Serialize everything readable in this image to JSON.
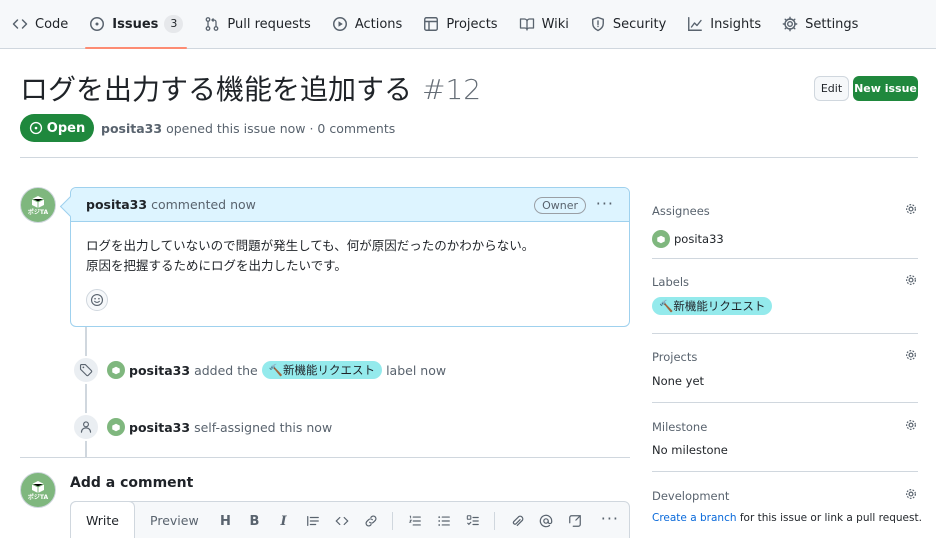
{
  "nav": {
    "items": [
      {
        "label": "Code",
        "icon": "code-icon"
      },
      {
        "label": "Issues",
        "icon": "issue-opened-icon",
        "count": "3"
      },
      {
        "label": "Pull requests",
        "icon": "git-pull-request-icon"
      },
      {
        "label": "Actions",
        "icon": "play-icon"
      },
      {
        "label": "Projects",
        "icon": "table-icon"
      },
      {
        "label": "Wiki",
        "icon": "book-icon"
      },
      {
        "label": "Security",
        "icon": "shield-icon"
      },
      {
        "label": "Insights",
        "icon": "graph-icon"
      },
      {
        "label": "Settings",
        "icon": "gear-icon"
      }
    ]
  },
  "issue": {
    "title": "ログを出力する機能を追加する",
    "number": "#12",
    "state": "Open",
    "author": "posita33",
    "meta": "opened this issue now · 0 comments",
    "edit_label": "Edit",
    "new_issue_label": "New issue"
  },
  "avatar_text": "ポジTA",
  "comment": {
    "author": "posita33",
    "when": "commented now",
    "badge": "Owner",
    "body_line1": "ログを出力していないので問題が発生しても、何が原因だったのかわからない。",
    "body_line2": "原因を把握するためにログを出力したいです。"
  },
  "timeline": [
    {
      "author": "posita33",
      "action": "added the",
      "label": "🔨新機能リクエスト",
      "suffix": "label now"
    },
    {
      "author": "posita33",
      "action": "self-assigned this now"
    }
  ],
  "add_comment": {
    "title": "Add a comment",
    "tab_write": "Write",
    "tab_preview": "Preview"
  },
  "sidebar": {
    "assignees": {
      "title": "Assignees",
      "value": "posita33"
    },
    "labels": {
      "title": "Labels",
      "value": "🔨新機能リクエスト"
    },
    "projects": {
      "title": "Projects",
      "value": "None yet"
    },
    "milestone": {
      "title": "Milestone",
      "value": "No milestone"
    },
    "development": {
      "title": "Development",
      "link": "Create a branch",
      "text": "for this issue or link a pull request."
    }
  },
  "colors": {
    "open": "#1f883d",
    "label_bg": "#94eaec",
    "comment_head": "#ddf4ff"
  }
}
